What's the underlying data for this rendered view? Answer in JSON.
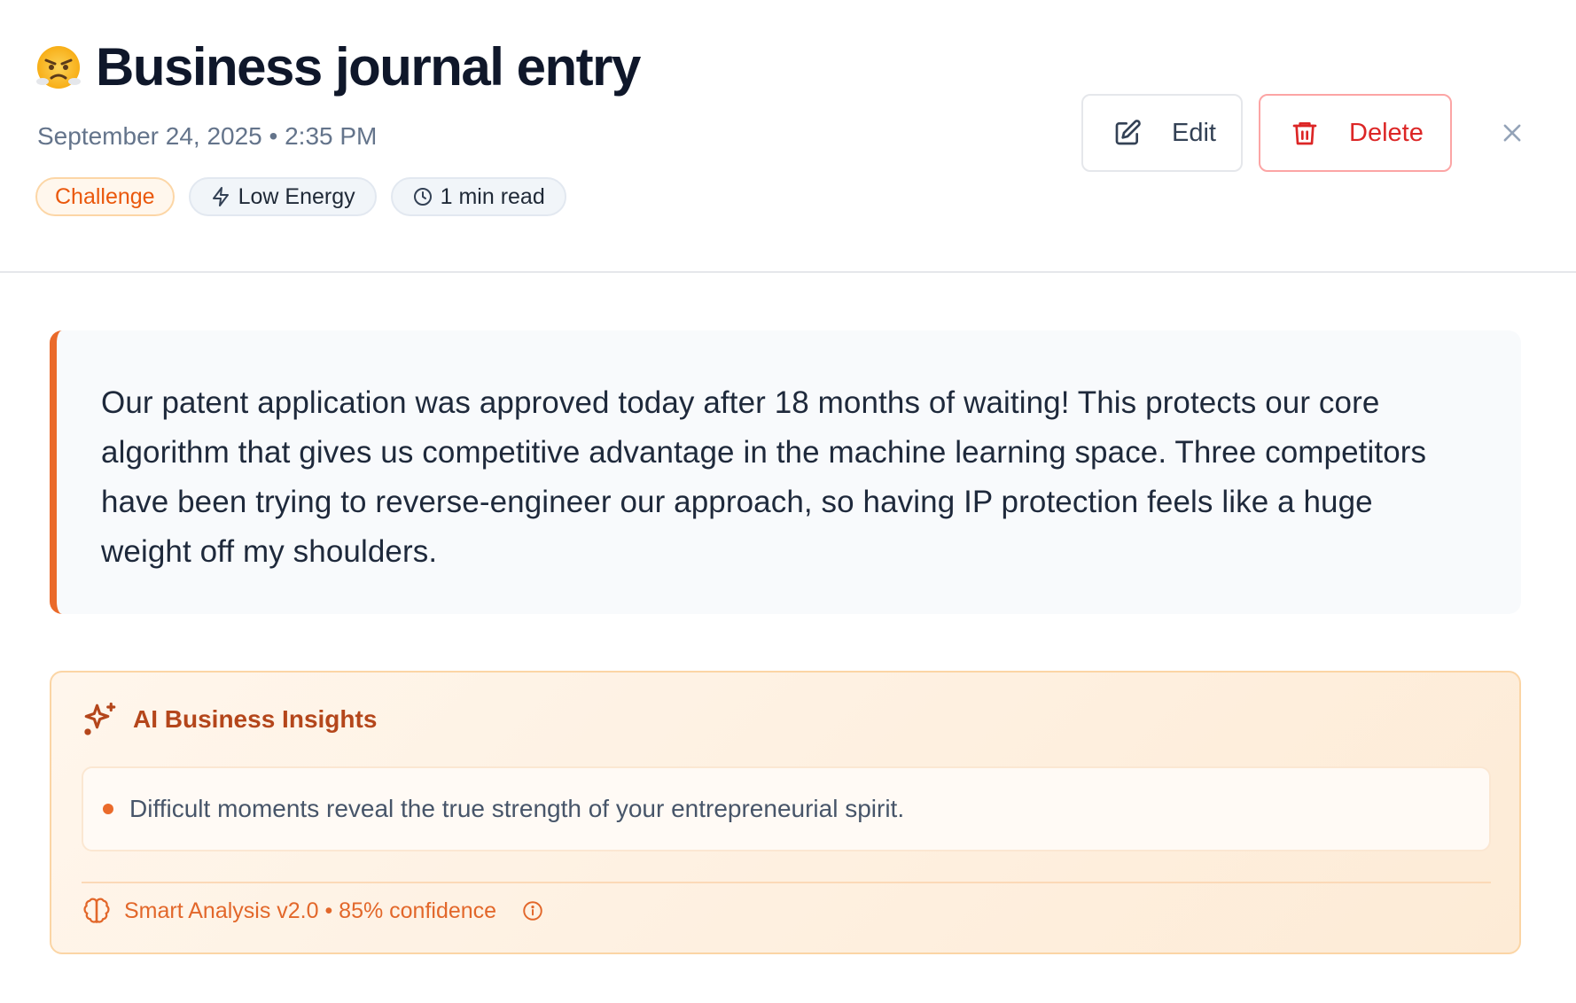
{
  "header": {
    "emoji_icon": "angry-face-emoji",
    "title": "Business journal entry",
    "date": "September 24, 2025 • 2:35 PM",
    "tags": [
      {
        "label": "Challenge",
        "icon": ""
      },
      {
        "label": "Low Energy",
        "icon": "lightning-icon"
      },
      {
        "label": "1 min read",
        "icon": "clock-icon"
      }
    ],
    "actions": {
      "edit_label": "Edit",
      "delete_label": "Delete",
      "close_icon": "close-icon"
    }
  },
  "entry": {
    "text": "Our patent application was approved today after 18 months of waiting! This protects our core algorithm that gives us competitive advantage in the machine learning space. Three competitors have been trying to reverse-engineer our approach, so having IP protection feels like a huge weight off my shoulders."
  },
  "insights": {
    "title": "AI Business Insights",
    "items": [
      "Difficult moments reveal the true strength of your entrepreneurial spirit."
    ],
    "footer": "Smart Analysis v2.0 • 85% confidence"
  },
  "colors": {
    "accent": "#ea6a2a",
    "danger": "#dc2626",
    "insight_title": "#b4461b"
  }
}
